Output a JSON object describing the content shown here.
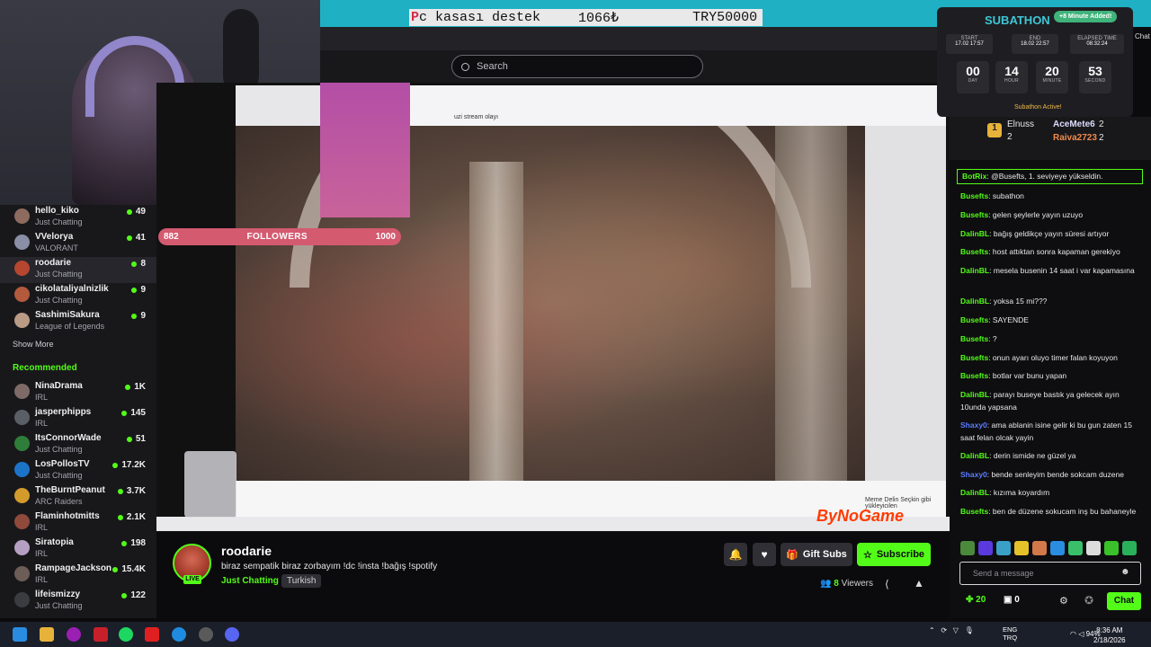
{
  "donation_bar": {
    "mark": "P",
    "text": "c kasası destek",
    "amount": "1066₺",
    "goal": "TRY50000"
  },
  "search": {
    "placeholder": "Search"
  },
  "follower_goal": {
    "current": "882",
    "label": "FOLLOWERS",
    "target": "1000"
  },
  "sidebar": {
    "following": [
      {
        "name": "hello_kiko",
        "game": "Just Chatting",
        "viewers": "49",
        "color": "#8d6b5e"
      },
      {
        "name": "VVelorya",
        "game": "VALORANT",
        "viewers": "41",
        "color": "#8a8fa6"
      },
      {
        "name": "roodarie",
        "game": "Just Chatting",
        "viewers": "8",
        "color": "#b5462f"
      },
      {
        "name": "cikolataliyalnizlik",
        "game": "Just Chatting",
        "viewers": "9",
        "color": "#b35a3c"
      },
      {
        "name": "SashimiSakura",
        "game": "League of Legends",
        "viewers": "9",
        "color": "#b99b86"
      }
    ],
    "show_more": "Show More",
    "recommended_header": "Recommended",
    "recommended": [
      {
        "name": "NinaDrama",
        "game": "IRL",
        "viewers": "1K",
        "color": "#7e6b68"
      },
      {
        "name": "jasperphipps",
        "game": "IRL",
        "viewers": "145",
        "color": "#5a5f66"
      },
      {
        "name": "ItsConnorWade",
        "game": "Just Chatting",
        "viewers": "51",
        "color": "#2f7d3a"
      },
      {
        "name": "LosPollosTV",
        "game": "Just Chatting",
        "viewers": "17.2K",
        "color": "#1c74c9"
      },
      {
        "name": "TheBurntPeanut",
        "game": "ARC Raiders",
        "viewers": "3.7K",
        "color": "#d39a2c"
      },
      {
        "name": "Flaminhotmitts",
        "game": "IRL",
        "viewers": "2.1K",
        "color": "#8f4a3b"
      },
      {
        "name": "Siratopia",
        "game": "IRL",
        "viewers": "198",
        "color": "#b59fc2"
      },
      {
        "name": "RampageJackson",
        "game": "IRL",
        "viewers": "15.4K",
        "color": "#6c5d56"
      },
      {
        "name": "lifeismizzy",
        "game": "Just Chatting",
        "viewers": "122",
        "color": "#3b3b42"
      }
    ]
  },
  "video": {
    "tab_text": "uzi stream olayı",
    "info_text": "Meme Delin Seçkin gibi yükleyicilen",
    "watermark": "ByNoGame"
  },
  "stream": {
    "streamer": "roodarie",
    "live": "LIVE",
    "title": "biraz sempatik biraz zorbayım !dc !insta !bağış !spotify",
    "category": "Just Chatting",
    "language": "Turkish",
    "viewers": "8",
    "viewers_label": "Viewers",
    "gift_subs": "Gift Subs",
    "subscribe": "Subscribe"
  },
  "subathon": {
    "title": "SUBATHON",
    "added": "+8 Minute Added!",
    "start_label": "START",
    "start": "17.02 17:57",
    "end_label": "END",
    "end": "18.02 22:57",
    "elapsed_label": "ELAPSED TIME",
    "elapsed": "08:32:24",
    "day": "00",
    "day_label": "DAY",
    "hour": "14",
    "hour_label": "HOUR",
    "minute": "20",
    "minute_label": "MINUTE",
    "second": "53",
    "second_label": "SECOND",
    "active": "Subathon Active!"
  },
  "top_gifters": [
    {
      "rank": "1",
      "name": "Elnuss",
      "count": "2"
    },
    {
      "name": "AceMete6",
      "count": "2"
    },
    {
      "name": "Raiva2723",
      "count": "2"
    }
  ],
  "chat": {
    "pinned": {
      "user": "BotRix",
      "text": "@Busefts, 1. seviyeye yükseldin."
    },
    "messages": [
      {
        "user": "Busefts",
        "text": "subathon",
        "color": "#53fc18"
      },
      {
        "user": "Busefts",
        "text": "gelen şeylerle yayın uzuyo",
        "color": "#53fc18"
      },
      {
        "user": "DalinBL",
        "text": "bağış geldikçe yayın süresi artıyor",
        "color": "#53fc18"
      },
      {
        "user": "Busefts",
        "text": "host attıktan sonra kapaman gerekiyo",
        "color": "#53fc18"
      },
      {
        "user": "DalinBL",
        "text": "mesela busenin 14 saat i var kapamasına",
        "color": "#53fc18"
      },
      {
        "user": "DalinBL",
        "text": "yoksa 15 mi???",
        "color": "#53fc18"
      },
      {
        "user": "Busefts",
        "text": "SAYENDE",
        "color": "#53fc18"
      },
      {
        "user": "Busefts",
        "text": "?",
        "color": "#53fc18"
      },
      {
        "user": "Busefts",
        "text": "onun ayarı oluyo timer falan koyuyon",
        "color": "#53fc18"
      },
      {
        "user": "Busefts",
        "text": "botlar var bunu yapan",
        "color": "#53fc18"
      },
      {
        "user": "DalinBL",
        "text": "parayı buseye bastık ya gelecek ayın 10unda yapsana",
        "color": "#53fc18"
      },
      {
        "user": "Shaxy0",
        "text": "ama ablanin isine gelir ki bu gun zaten 15 saat felan olcak yayin",
        "color": "#5b7bff"
      },
      {
        "user": "DalinBL",
        "text": "derin ismide ne güzel ya",
        "color": "#53fc18"
      },
      {
        "user": "Shaxy0",
        "text": "bende senleyim bende sokcam duzene",
        "color": "#5b7bff"
      },
      {
        "user": "DalinBL",
        "text": "kızıma koyardım",
        "color": "#53fc18"
      },
      {
        "user": "Busefts",
        "text": "ben de düzene sokucam inş bu bahaneyle",
        "color": "#53fc18"
      }
    ],
    "input_placeholder": "Send a message",
    "points": "20",
    "gifts": "0",
    "send": "Chat",
    "tab": "Chat"
  },
  "taskbar": {
    "lang_1": "ENG",
    "lang_2": "TRQ",
    "battery": "94%",
    "time": "8:36 AM",
    "date": "2/18/2026"
  }
}
